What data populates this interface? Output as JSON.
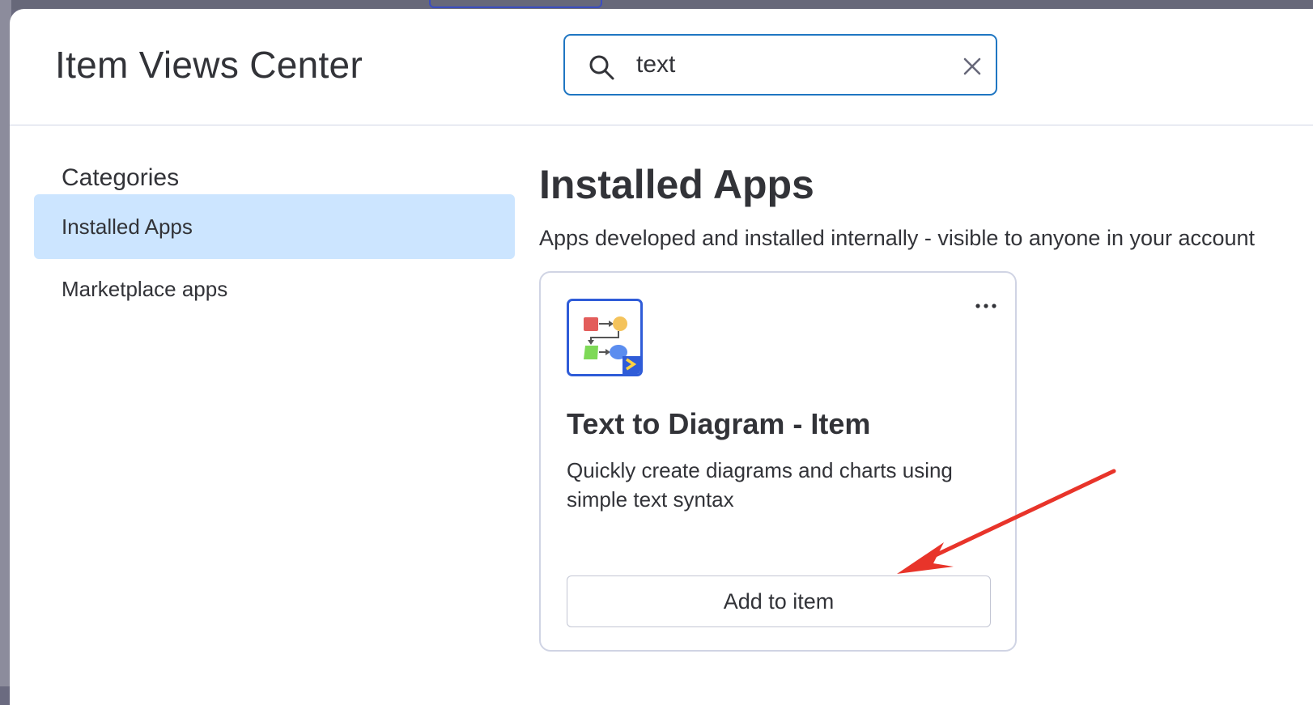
{
  "modal": {
    "title": "Item Views Center"
  },
  "search": {
    "value": "text",
    "placeholder": ""
  },
  "sidebar": {
    "heading": "Categories",
    "items": [
      {
        "label": "Installed Apps",
        "active": true
      },
      {
        "label": "Marketplace apps",
        "active": false
      }
    ]
  },
  "section": {
    "title": "Installed Apps",
    "description": "Apps developed and installed internally - visible to anyone in your account"
  },
  "apps": [
    {
      "name": "Text to Diagram - Item",
      "description": "Quickly create diagrams and charts using simple text syntax",
      "action_label": "Add to item",
      "icon": "text-to-diagram-logo"
    }
  ],
  "colors": {
    "accent": "#1f76c2",
    "selected_bg": "#cce5ff",
    "annotation_arrow": "#e8342a"
  }
}
